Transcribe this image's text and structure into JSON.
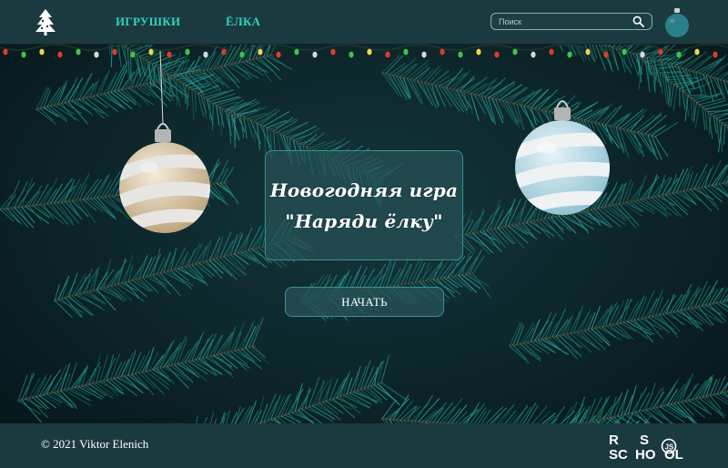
{
  "nav": {
    "toys_label": "ИГРУШКИ",
    "tree_label": "ЁЛКА"
  },
  "search": {
    "placeholder": "Поиск",
    "value": ""
  },
  "cart": {
    "count": ""
  },
  "main": {
    "title_line1": "Новогодняя игра",
    "title_line2": "\"Наряди ёлку\"",
    "start_button": "НАЧАТЬ"
  },
  "footer": {
    "copyright": "© 2021 Viktor Elenich",
    "school_logo_text": "RS SCHOOL JS"
  },
  "colors": {
    "accent": "#2fd3bf",
    "header_bg": "#1b3a40",
    "panel_border": "#3a8f95",
    "cart_ball": "#2a7f8c"
  },
  "icons": {
    "logo": "christmas-tree-icon",
    "search": "search-icon",
    "cart": "ornament-ball-icon"
  }
}
